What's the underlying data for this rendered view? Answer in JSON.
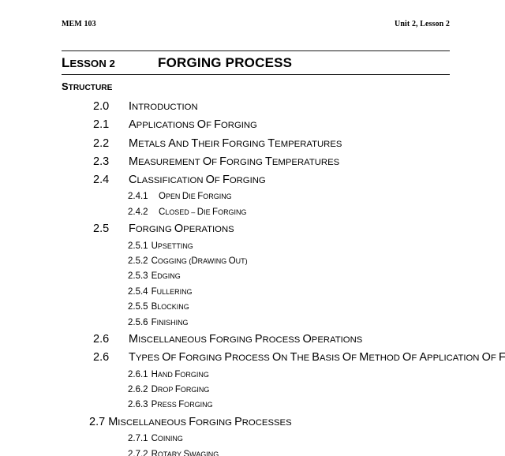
{
  "header": {
    "course_code": "MEM 103",
    "unit_lesson": "Unit 2, Lesson 2"
  },
  "title": {
    "lesson_label": "LESSON 2",
    "lesson_name": "FORGING PROCESS"
  },
  "structure": {
    "heading": "STRUCTURE"
  },
  "toc": {
    "entries": [
      {
        "level": 1,
        "number": "2.0",
        "label": "INTRODUCTION"
      },
      {
        "level": 1,
        "number": "2.1",
        "label": "APPLICATIONS OF FORGING"
      },
      {
        "level": 1,
        "number": "2.2",
        "label": "METALS AND THEIR FORGING TEMPERATURES"
      },
      {
        "level": 1,
        "number": "2.3",
        "label": "MEASUREMENT OF FORGING TEMPERATURES"
      },
      {
        "level": 1,
        "number": "2.4",
        "label": "CLASSIFICATION OF FORGING"
      },
      {
        "level": 2,
        "number": "2.4.1",
        "label": "OPEN DIE FORGING"
      },
      {
        "level": 2,
        "number": "2.4.2",
        "label": "CLOSED – DIE FORGING"
      },
      {
        "level": 1,
        "number": "2.5",
        "label": "FORGING OPERATIONS"
      },
      {
        "level": 2,
        "number": "2.5.1",
        "label": "UPSETTING"
      },
      {
        "level": 2,
        "number": "2.5.2",
        "label": "COGGING (DRAWING OUT)"
      },
      {
        "level": 2,
        "number": "2.5.3",
        "label": "EDGING"
      },
      {
        "level": 2,
        "number": "2.5.4",
        "label": "FULLERING"
      },
      {
        "level": 2,
        "number": "2.5.5",
        "label": "BLOCKING"
      },
      {
        "level": 2,
        "number": "2.5.6",
        "label": "FINISHING"
      },
      {
        "level": 1,
        "number": "2.6",
        "label": "MISCELLANEOUS FORGING PROCESS OPERATIONS"
      },
      {
        "level": 1,
        "number": "2.6",
        "label": "TYPES OF FORGING PROCESS ON THE BASIS OF METHOD OF APPLICATION OF FORCE"
      },
      {
        "level": 2,
        "number": "2.6.1",
        "label": "HAND FORGING"
      },
      {
        "level": 2,
        "number": "2.6.2",
        "label": "DROP FORGING"
      },
      {
        "level": 2,
        "number": "2.6.3",
        "label": "PRESS FORGING"
      },
      {
        "level": 1,
        "number": "2.7",
        "label": "MISCELLANEOUS FORGING PROCESSES"
      },
      {
        "level": 2,
        "number": "2.7.1",
        "label": "COINING"
      },
      {
        "level": 2,
        "number": "2.7.2",
        "label": "ROTARY SWAGING"
      }
    ]
  }
}
